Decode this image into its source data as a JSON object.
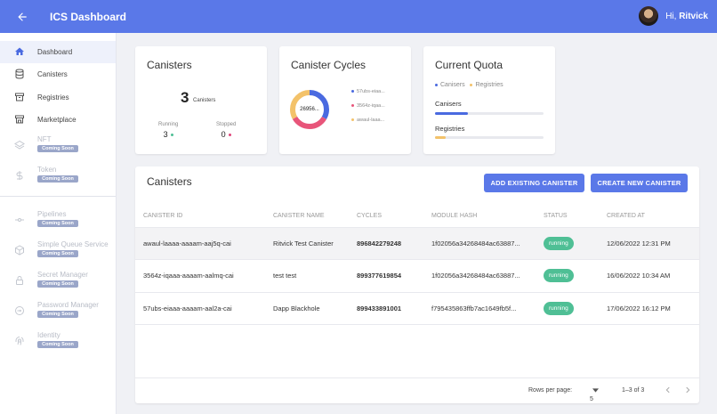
{
  "header": {
    "title": "ICS Dashboard",
    "greeting": "Hi,",
    "user_name": "Ritvick",
    "accent": "#5a78e8"
  },
  "sidebar": {
    "items": [
      {
        "label": "Dashboard",
        "icon": "home-icon"
      },
      {
        "label": "Canisters",
        "icon": "database-icon"
      },
      {
        "label": "Registries",
        "icon": "archive-icon"
      },
      {
        "label": "Marketplace",
        "icon": "store-icon"
      },
      {
        "label": "NFT",
        "icon": "layers-icon",
        "badge": "Coming Soon"
      },
      {
        "label": "Token",
        "icon": "dollar-icon",
        "badge": "Coming Soon"
      },
      {
        "label": "Pipelines",
        "icon": "pipeline-icon",
        "badge": "Coming Soon"
      },
      {
        "label": "Simple Queue Service",
        "icon": "cube-icon",
        "badge": "Coming Soon"
      },
      {
        "label": "Secret Manager",
        "icon": "lock-icon",
        "badge": "Coming Soon"
      },
      {
        "label": "Password Manager",
        "icon": "key-icon",
        "badge": "Coming Soon"
      },
      {
        "label": "Identity",
        "icon": "fingerprint-icon",
        "badge": "Coming Soon"
      }
    ]
  },
  "summary": {
    "title": "Canisters",
    "total": "3",
    "total_unit": "Canisters",
    "running_label": "Running",
    "running": "3",
    "stopped_label": "Stopped",
    "stopped": "0"
  },
  "cycles": {
    "title": "Canister Cycles",
    "center_label": "26956...",
    "legend": [
      "57ubs-eiaa...",
      "3564z-iqaa...",
      "awaul-laaa..."
    ],
    "colors": [
      "#4a6ae0",
      "#e8557a",
      "#f3c26a"
    ]
  },
  "quota": {
    "title": "Current Quota",
    "legend": [
      "Canisers",
      "Registries"
    ],
    "canisters_label": "Canisers",
    "canisters_fraction": 0.3,
    "registries_label": "Registries",
    "registries_fraction": 0.1,
    "colors": [
      "#4a6ae0",
      "#f3c26a"
    ]
  },
  "table": {
    "title": "Canisters",
    "add_button": "ADD EXISTING CANISTER",
    "create_button": "CREATE NEW CANISTER",
    "columns": [
      "CANISTER ID",
      "CANISTER NAME",
      "CYCLES",
      "MODULE HASH",
      "STATUS",
      "CREATED AT"
    ],
    "rows": [
      {
        "id": "awaul-laaaa-aaaam-aaj5q-cai",
        "name": "Ritvick Test Canister",
        "cycles": "896842279248",
        "hash": "1f02056a34268484ac63887...",
        "status": "running",
        "created": "12/06/2022 12:31 PM"
      },
      {
        "id": "3564z-iqaaa-aaaam-aalmq-cai",
        "name": "test test",
        "cycles": "899377619854",
        "hash": "1f02056a34268484ac63887...",
        "status": "running",
        "created": "16/06/2022 10:34 AM"
      },
      {
        "id": "57ubs-eiaaa-aaaam-aal2a-cai",
        "name": "Dapp Blackhole",
        "cycles": "899433891001",
        "hash": "f795435863ffb7ac1649fb5f...",
        "status": "running",
        "created": "17/06/2022 16:12 PM"
      }
    ],
    "rows_per_page_label": "Rows per page:",
    "rows_per_page": "5",
    "range": "1–3 of 3"
  }
}
